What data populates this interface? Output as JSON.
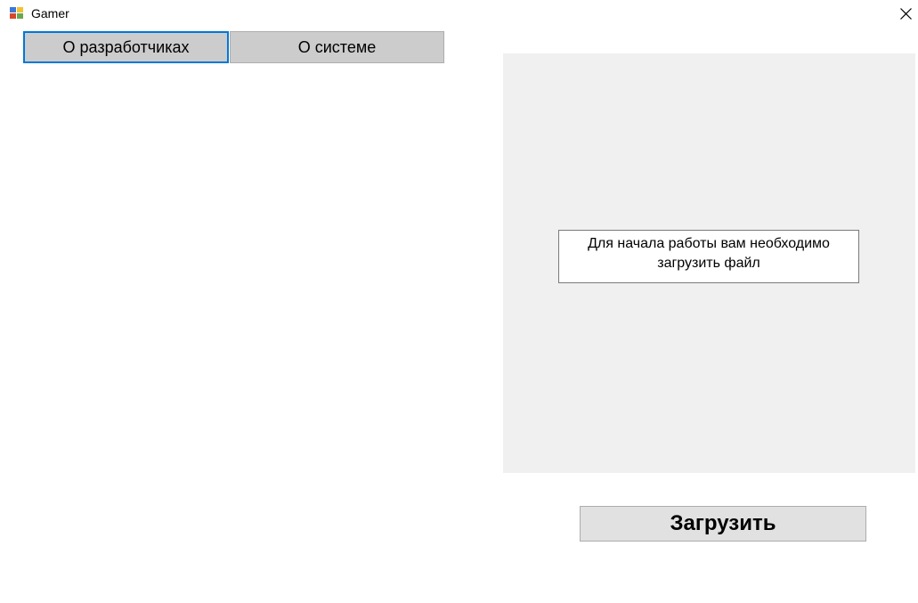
{
  "window": {
    "title": "Gamer",
    "icon": "app-window-icon",
    "close_icon": "close-icon"
  },
  "tabs": [
    {
      "label": "О разработчиках",
      "active": true
    },
    {
      "label": "О системе",
      "active": false
    }
  ],
  "panel": {
    "message": "Для начала работы вам необходимо загрузить файл",
    "background": "#f0f0f0"
  },
  "actions": {
    "load_label": "Загрузить"
  },
  "colors": {
    "accent": "#0078d7",
    "button_bg": "#cccccc",
    "panel_bg": "#f0f0f0"
  }
}
